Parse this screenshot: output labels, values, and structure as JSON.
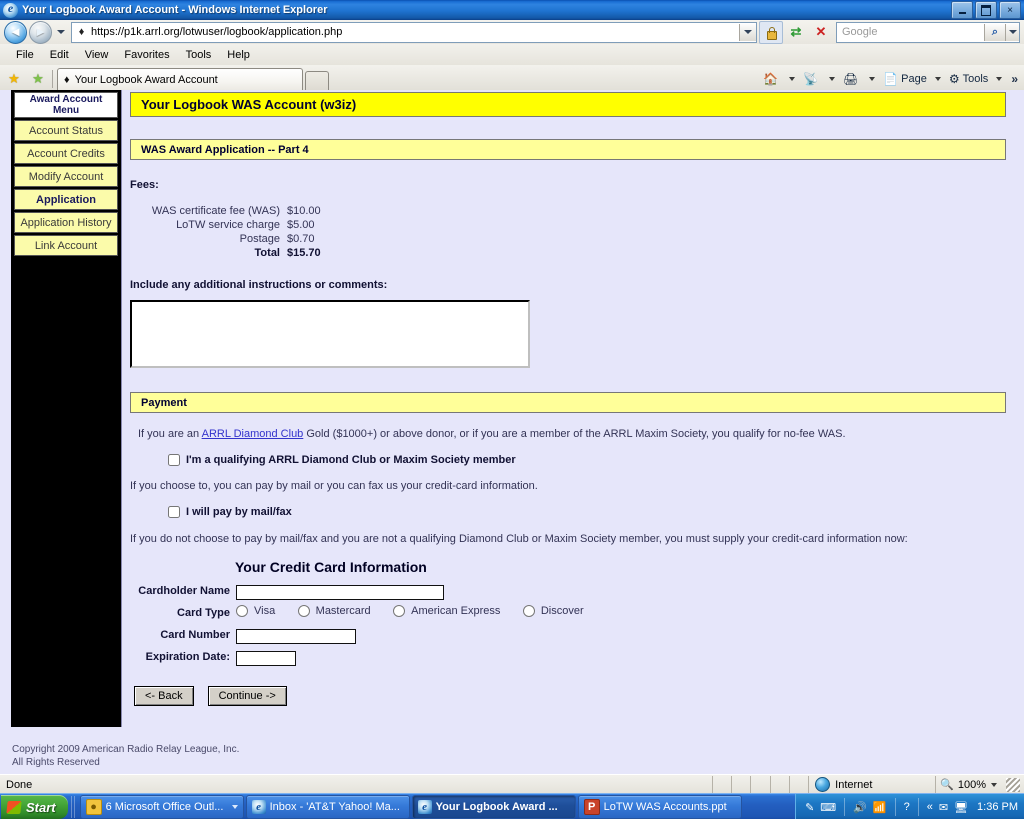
{
  "window": {
    "title": "Your Logbook Award Account - Windows Internet Explorer",
    "minimize_label": "Minimize",
    "maximize_label": "Maximize",
    "close_label": "×"
  },
  "browser": {
    "back_label": "◄",
    "forward_label": "►",
    "url": "https://p1k.arrl.org/lotwuser/logbook/application.php",
    "search_placeholder": "Google",
    "search_go_label": "⌕",
    "menu": [
      "File",
      "Edit",
      "View",
      "Favorites",
      "Tools",
      "Help"
    ],
    "tab_label": "Your Logbook Award Account",
    "commands": {
      "home": "Home",
      "feeds": "Feeds",
      "print": "Print",
      "page": "Page",
      "tools": "Tools",
      "overflow": "»"
    }
  },
  "sidebar": {
    "heading_line1": "Award Account",
    "heading_line2": "Menu",
    "items": [
      {
        "label": "Account Status",
        "active": false
      },
      {
        "label": "Account Credits",
        "active": false
      },
      {
        "label": "Modify Account",
        "active": false
      },
      {
        "label": "Application",
        "active": true
      },
      {
        "label": "Application History",
        "active": false
      },
      {
        "label": "Link Account",
        "active": false
      }
    ]
  },
  "page": {
    "banner": "Your Logbook WAS Account (w3iz)",
    "subbanner": "WAS Award Application -- Part 4",
    "fees_heading": "Fees:",
    "fees": [
      {
        "label": "WAS certificate fee (WAS)",
        "amount": "$10.00",
        "total": false
      },
      {
        "label": "LoTW service charge",
        "amount": "$5.00",
        "total": false
      },
      {
        "label": "Postage",
        "amount": "$0.70",
        "total": false
      },
      {
        "label": "Total",
        "amount": "$15.70",
        "total": true
      }
    ],
    "comments_label": "Include any additional instructions or comments:",
    "comments_value": "",
    "payment_banner": "Payment",
    "donor_text_before": "If you are an ",
    "donor_link": "ARRL Diamond Club",
    "donor_text_after": " Gold ($1000+) or above donor, or if you are a member of the ARRL Maxim Society, you qualify for no-fee WAS.",
    "checkbox_diamond": "I'm a qualifying ARRL Diamond Club or Maxim Society member",
    "mailfax_text": "If you choose to, you can pay by mail or you can fax us your credit-card information.",
    "checkbox_mailfax": "I will pay by mail/fax",
    "cc_required_text": "If you do not choose to pay by mail/fax and you are not a qualifying Diamond Club or Maxim Society member, you must supply your credit-card information now:",
    "cc_title": "Your Credit Card Information",
    "cc_fields": {
      "cardholder_label": "Cardholder Name",
      "cardholder_value": "",
      "cardtype_label": "Card Type",
      "cardtypes": [
        "Visa",
        "Mastercard",
        "American Express",
        "Discover"
      ],
      "cardnumber_label": "Card Number",
      "cardnumber_value": "",
      "expiration_label": "Expiration Date:",
      "expiration_value": ""
    },
    "back_button": "<- Back",
    "continue_button": "Continue ->",
    "copyright_line1": "Copyright 2009 American Radio Relay League, Inc.",
    "copyright_line2": "All Rights Reserved"
  },
  "statusbar": {
    "message": "Done",
    "zone": "Internet",
    "zoom": "100%"
  },
  "taskbar": {
    "start_label": "Start",
    "items": [
      {
        "label": "6 Microsoft Office Outl...",
        "icon": "outlook-icon",
        "active": false,
        "has_dropdown": true
      },
      {
        "label": "Inbox - 'AT&T Yahoo! Ma...",
        "icon": "ie-icon",
        "active": false,
        "has_dropdown": false
      },
      {
        "label": "Your Logbook Award ...",
        "icon": "ie-icon",
        "active": true,
        "has_dropdown": false
      },
      {
        "label": "LoTW WAS Accounts.ppt",
        "icon": "powerpoint-icon",
        "active": false,
        "has_dropdown": false
      }
    ],
    "tray_overflow": "«",
    "clock": "1:36 PM"
  },
  "colors": {
    "page_background": "#e6e6fa",
    "banner_yellow": "#ffff00",
    "subbanner_yellow": "#ffff99",
    "menu_yellow": "#fbfbaa",
    "link_blue": "#3333cc"
  }
}
